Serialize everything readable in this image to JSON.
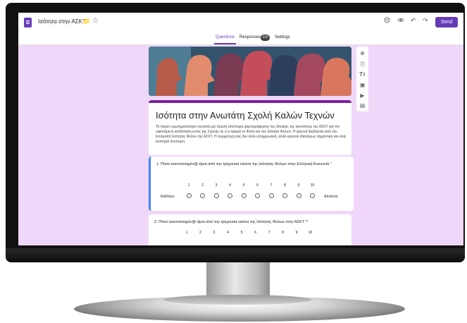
{
  "app": {
    "title": "Ισότητα στην ΑΣΚΤ",
    "send_label": "Send"
  },
  "tabs": [
    {
      "label": "Questions",
      "active": true
    },
    {
      "label": "Responses",
      "badge": "110"
    },
    {
      "label": "Settings"
    }
  ],
  "form": {
    "title": "Ισότητα στην Ανωτάτη Σχολή Καλών Τεχνών",
    "description": "Το παρόν ερωτηματολόγιο συνιστά μια πρώτη απόπειρα χαρτογράφησης της άποψης της κοινότητας της ΑΣΚΤ για την υφιστάμενη κατάσταση εντός της Σχολής σε ό,τι αφορά το Φύλο και την Ισότητα Φύλων. Η έρευνα διεξάγεται από την Επιτροπή Ισότητας Φύλου της ΑΣΚΤ. Η συμμετοχή σας δεν είναι υποχρεωτική, αλλά κρίνεται ιδιαιτέρως σημαντική και είναι αυστηρά ανώνυμη.",
    "questions": [
      {
        "text": "1. Πόσο ικανοποιημέν@ είμαι από την τρέχουσα εικόνα της Ισότητας Φύλων στην Ελληνική Κοινωνία",
        "required_mark": "*",
        "scale": [
          "1",
          "2",
          "3",
          "4",
          "5",
          "6",
          "7",
          "8",
          "9",
          "10"
        ],
        "min_label": "Καθόλου",
        "max_label": "Απόλυτα"
      },
      {
        "text": "2. Πόσο ικανοποιημέν@ είμαι από την τρέχουσα εικόνα της Ισότητας Φύλων στην ΑΣΚΤ *",
        "required_mark": "*",
        "scale": [
          "1",
          "2",
          "3",
          "4",
          "5",
          "6",
          "7",
          "8",
          "9",
          "10"
        ]
      }
    ]
  },
  "colors": {
    "accent": "#673ab7",
    "page_bg": "#f0d7f9",
    "question_highlight": "#4285f4",
    "required": "#d93025"
  },
  "icons": {
    "app": "forms-icon",
    "folder": "folder-icon",
    "star": "star-icon",
    "palette": "palette-icon",
    "preview": "eye-icon",
    "undo": "undo-icon",
    "redo": "redo-icon",
    "side": [
      "add-question-icon",
      "import-questions-icon",
      "add-title-icon",
      "add-image-icon",
      "add-video-icon",
      "add-section-icon"
    ]
  }
}
